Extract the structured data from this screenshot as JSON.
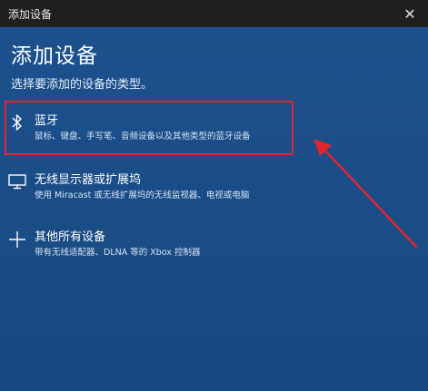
{
  "window": {
    "title": "添加设备",
    "close_icon": "close-icon"
  },
  "main": {
    "heading": "添加设备",
    "subheading": "选择要添加的设备的类型。"
  },
  "options": [
    {
      "title": "蓝牙",
      "description": "鼠标、键盘、手写笔、音频设备以及其他类型的蓝牙设备",
      "icon": "bluetooth-icon"
    },
    {
      "title": "无线显示器或扩展坞",
      "description": "使用 Miracast 或无线扩展坞的无线监视器、电视或电脑",
      "icon": "monitor-icon"
    },
    {
      "title": "其他所有设备",
      "description": "带有无线适配器、DLNA 等的 Xbox 控制器",
      "icon": "plus-icon"
    }
  ],
  "annotation": {
    "color": "#e0262c"
  }
}
